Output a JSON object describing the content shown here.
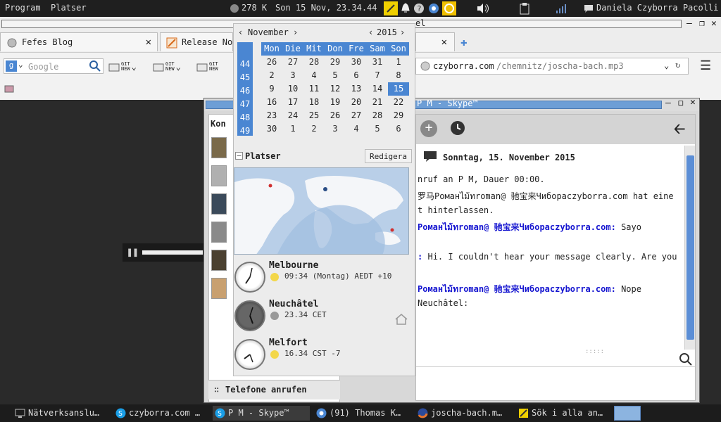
{
  "top_panel": {
    "menu_program": "Program",
    "menu_places": "Platser",
    "memory": "278 K",
    "datetime": "Son 15 Nov, 23.34.44",
    "user": "Daniela Czyborra Pacolli"
  },
  "browser": {
    "title_fragment": "el",
    "tabs": [
      {
        "label": "Fefes Blog"
      },
      {
        "label": "Release No"
      }
    ],
    "search_placeholder": "Google",
    "folder_labels": [
      "GIT\nNEW",
      "GIT\nNEW",
      "GIT\nNEW"
    ],
    "url_host": "czyborra.com",
    "url_path": "/chemnitz/joscha-bach.mp3"
  },
  "skype": {
    "title": "P M - Skype™",
    "contacts_header": "Kon",
    "call_button": "Telefone anrufen",
    "date_header": "Sonntag, 15. November 2015",
    "messages": [
      {
        "text": "nruf an P M, Dauer 00:00.",
        "style": "normal"
      },
      {
        "text": "罗马Романไม้ทroman@ 驰宝来Чиборaczyborra.com hat eine",
        "style": "normal"
      },
      {
        "text": "t hinterlassen.",
        "style": "normal"
      },
      {
        "text": "Романไม้ทroman@ 驰宝来Чиборaczyborra.com:",
        "style": "blue",
        "suffix": "Sayo"
      },
      {
        "text": ":",
        "style": "blue",
        "suffix": "Hi. I couldn't hear your message clearly. Are you"
      },
      {
        "text": "Романไม้ทroman@ 驰宝来Чиборaczyborra.com:",
        "style": "blue",
        "suffix": "Nope"
      },
      {
        "text": "Neuchâtel:",
        "style": "normal"
      }
    ]
  },
  "calendar": {
    "month": "November",
    "year": "2015",
    "day_names": [
      "Mon",
      "Die",
      "Mit",
      "Don",
      "Fre",
      "Sam",
      "Son"
    ],
    "weeks": [
      {
        "wk": "44",
        "days": [
          "26",
          "27",
          "28",
          "29",
          "30",
          "31",
          "1"
        ]
      },
      {
        "wk": "45",
        "days": [
          "2",
          "3",
          "4",
          "5",
          "6",
          "7",
          "8"
        ]
      },
      {
        "wk": "46",
        "days": [
          "9",
          "10",
          "11",
          "12",
          "13",
          "14",
          "15"
        ]
      },
      {
        "wk": "47",
        "days": [
          "16",
          "17",
          "18",
          "19",
          "20",
          "21",
          "22"
        ]
      },
      {
        "wk": "48",
        "days": [
          "23",
          "24",
          "25",
          "26",
          "27",
          "28",
          "29"
        ]
      },
      {
        "wk": "49",
        "days": [
          "30",
          "1",
          "2",
          "3",
          "4",
          "5",
          "6"
        ]
      }
    ],
    "selected_day": "15",
    "places_label": "Platser",
    "edit_button": "Redigera",
    "locations": [
      {
        "name": "Melbourne",
        "info": "09:34 (Montag) AEDT +10",
        "weather": "sunny"
      },
      {
        "name": "Neuchâtel",
        "info": "23.34 CET",
        "weather": "night"
      },
      {
        "name": "Melfort",
        "info": "16.34 CST -7",
        "weather": "sunny"
      }
    ]
  },
  "taskbar": {
    "items": [
      {
        "label": "Nätverksanslu…",
        "icon": "network-icon"
      },
      {
        "label": "czyborra.com …",
        "icon": "skype-icon"
      },
      {
        "label": "P M - Skype™",
        "icon": "skype-icon"
      },
      {
        "label": "(91) Thomas K…",
        "icon": "chromium-icon"
      },
      {
        "label": "joscha-bach.m…",
        "icon": "firefox-icon"
      },
      {
        "label": "Sök i alla an…",
        "icon": "notes-icon"
      }
    ]
  },
  "colors": {
    "accent": "#4a86d2",
    "skype_blue": "#1515d0"
  }
}
